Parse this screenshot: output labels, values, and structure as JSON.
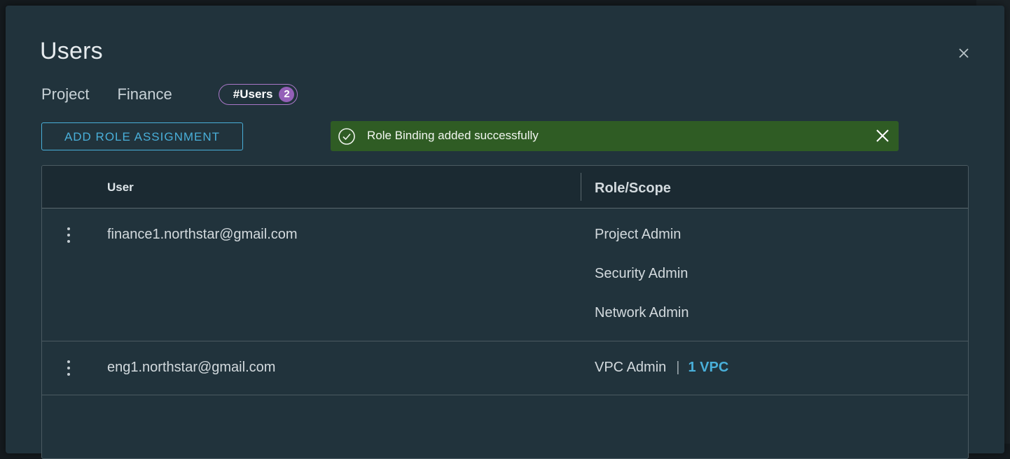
{
  "modal": {
    "title": "Users",
    "project_label": "Project",
    "project_value": "Finance",
    "users_badge_label": "#Users",
    "users_count": "2",
    "close_icon": "close-icon"
  },
  "toolbar": {
    "add_role_label": "ADD ROLE ASSIGNMENT"
  },
  "alert": {
    "message": "Role Binding added successfully",
    "status_icon": "check-circle-icon",
    "close_icon": "close-icon",
    "color": "#2f5c24"
  },
  "table": {
    "columns": [
      "User",
      "Role/Scope"
    ],
    "rows": [
      {
        "user": "finance1.northstar@gmail.com",
        "roles": [
          "Project Admin",
          "Security Admin",
          "Network Admin"
        ]
      },
      {
        "user": "eng1.northstar@gmail.com",
        "roles": [
          "VPC Admin"
        ],
        "separator": "|",
        "scope_link": "1 VPC"
      }
    ]
  },
  "colors": {
    "accent": "#49afd9",
    "badge": "#9460b8",
    "background": "#21333c"
  }
}
